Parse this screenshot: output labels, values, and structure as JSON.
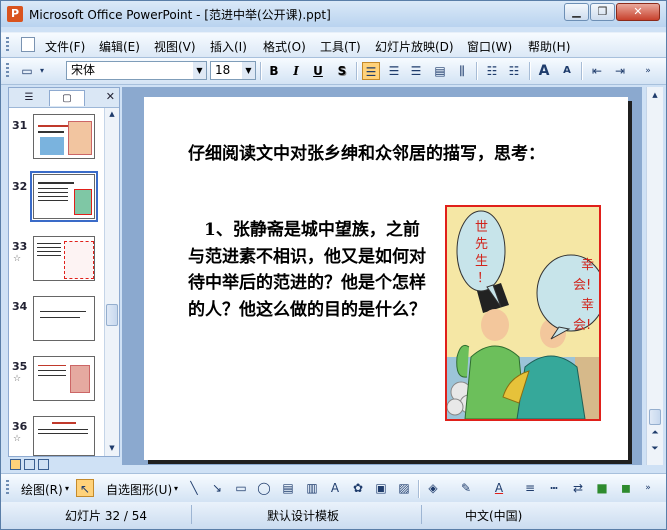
{
  "window": {
    "title": "Microsoft Office PowerPoint - [范进中举(公开课).ppt]",
    "app_icon": "P",
    "controls": [
      "minimize-icon",
      "restore-icon",
      "close-icon"
    ]
  },
  "menubar": {
    "items": [
      "文件(F)",
      "编辑(E)",
      "视图(V)",
      "插入(I)",
      "格式(O)",
      "工具(T)",
      "幻灯片放映(D)",
      "窗口(W)",
      "帮助(H)"
    ]
  },
  "format_toolbar": {
    "font_name": "宋体",
    "font_size": "18",
    "bold": "B",
    "italic": "I",
    "underline": "U",
    "shadow": "S",
    "grow_font": "A",
    "shrink_font": "A"
  },
  "slides_panel": {
    "slides": [
      {
        "number": "31",
        "has_star": false
      },
      {
        "number": "32",
        "has_star": false,
        "selected": true
      },
      {
        "number": "33",
        "has_star": true
      },
      {
        "number": "34",
        "has_star": false
      },
      {
        "number": "35",
        "has_star": true
      },
      {
        "number": "36",
        "has_star": true
      }
    ],
    "star_glyph": "☆"
  },
  "current_slide": {
    "title": "仔细阅读文中对张乡绅和众邻居的描写，思考：",
    "body": "1、张静斋是城中望族，之前 与范进素不相识，他又是如何对待中举后的范进的？他是个怎样的人？他这么做的目的是什么？",
    "bubble_left": [
      "世",
      "先",
      "生",
      "！"
    ],
    "bubble_right": [
      "幸",
      "会!",
      "幸",
      "会!"
    ]
  },
  "drawing_toolbar": {
    "draw_menu": "绘图(R)",
    "autoshapes_menu": "自选图形(U)"
  },
  "statusbar": {
    "slide_position": "幻灯片 32 / 54",
    "template": "默认设计模板",
    "language": "中文(中国)"
  },
  "colors": {
    "accent_red": "#e0201a",
    "window_blue": "#cfe1f5"
  }
}
